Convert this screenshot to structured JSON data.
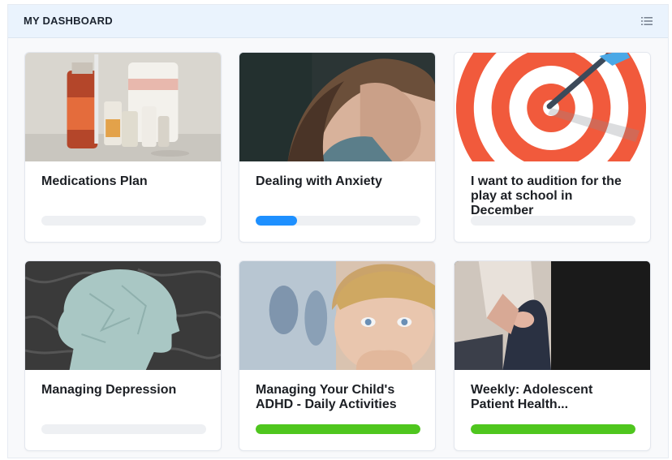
{
  "header": {
    "title": "MY DASHBOARD"
  },
  "colors": {
    "progress_blue": "#1e90ff",
    "progress_green": "#4fc61e",
    "track": "#eef0f3"
  },
  "cards": [
    {
      "title": "Medications Plan",
      "image": "medication-bottles-image",
      "progress": 0.0,
      "progress_color": "#1e90ff"
    },
    {
      "title": "Dealing with Anxiety",
      "image": "anxious-woman-image",
      "progress": 0.25,
      "progress_color": "#1e90ff"
    },
    {
      "title": "I want to audition for the play at school in December",
      "image": "target-dart-image",
      "progress": 0.0,
      "progress_color": "#1e90ff"
    },
    {
      "title": "Managing Depression",
      "image": "crumpled-head-paper-image",
      "progress": 0.0,
      "progress_color": "#1e90ff"
    },
    {
      "title": "Managing Your Child's ADHD - Daily Activities",
      "image": "worried-boy-image",
      "progress": 1.0,
      "progress_color": "#4fc61e"
    },
    {
      "title": "Weekly: Adolescent Patient Health...",
      "image": "adolescent-patient-image",
      "progress": 1.0,
      "progress_color": "#4fc61e"
    }
  ]
}
